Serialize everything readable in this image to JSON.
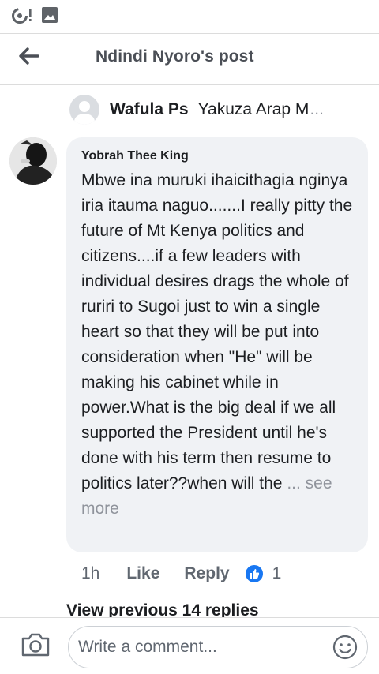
{
  "status_bar": {
    "icons": [
      "data-saver-icon",
      "image-icon"
    ]
  },
  "header": {
    "title": "Ndindi Nyoro's post",
    "back_icon": "arrow-left-icon"
  },
  "reply_context": {
    "name": "Wafula Ps",
    "snippet": "Yakuza Arap M",
    "ellipsis": "..."
  },
  "comment": {
    "author": "Yobrah Thee King",
    "text": "Mbwe ina muruki ihaicithagia nginya iria itauma naguo.......I really pitty the future of Mt Kenya politics and citizens....if a few leaders with individual desires drags the whole of ruriri to Sugoi just to win a single heart so that they will be put into consideration when \"He\" will be making his cabinet while in power.What is the big deal if we all supported the President until he's done with his term then resume to politics later??when will the",
    "see_more": "... see more",
    "timestamp": "1h",
    "like_label": "Like",
    "reply_label": "Reply",
    "reaction_icon": "thumbs-up-icon",
    "reaction_count": "1"
  },
  "view_previous": "View previous 14 replies",
  "composer": {
    "placeholder": "Write a comment...",
    "camera_icon": "camera-icon",
    "emoji_icon": "smiley-icon"
  },
  "colors": {
    "bubble": "#f0f2f5",
    "muted_text": "#606770",
    "like_blue": "#1877f2",
    "header_text": "#4b4f56"
  }
}
